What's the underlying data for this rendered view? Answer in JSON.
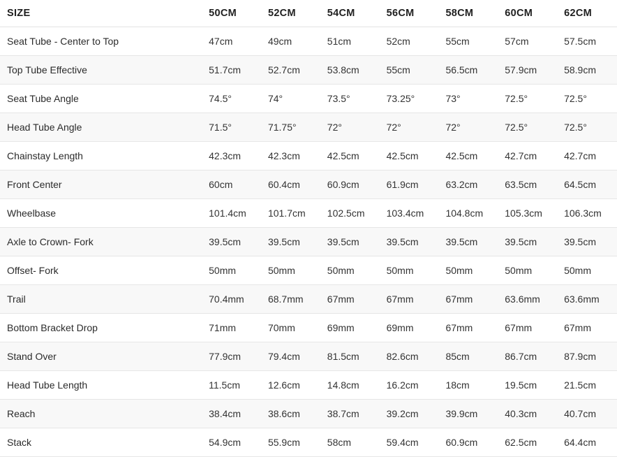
{
  "table": {
    "label_header": "SIZE",
    "size_headers": [
      "50CM",
      "52CM",
      "54CM",
      "56CM",
      "58CM",
      "60CM",
      "62CM"
    ],
    "rows": [
      {
        "label": "Seat Tube - Center to Top",
        "values": [
          "47cm",
          "49cm",
          "51cm",
          "52cm",
          "55cm",
          "57cm",
          "57.5cm"
        ]
      },
      {
        "label": "Top Tube Effective",
        "values": [
          "51.7cm",
          "52.7cm",
          "53.8cm",
          "55cm",
          "56.5cm",
          "57.9cm",
          "58.9cm"
        ]
      },
      {
        "label": "Seat Tube Angle",
        "values": [
          "74.5°",
          "74°",
          "73.5°",
          "73.25°",
          "73°",
          "72.5°",
          "72.5°"
        ]
      },
      {
        "label": "Head Tube Angle",
        "values": [
          "71.5°",
          "71.75°",
          "72°",
          "72°",
          "72°",
          "72.5°",
          "72.5°"
        ]
      },
      {
        "label": "Chainstay Length",
        "values": [
          "42.3cm",
          "42.3cm",
          "42.5cm",
          "42.5cm",
          "42.5cm",
          "42.7cm",
          "42.7cm"
        ]
      },
      {
        "label": "Front Center",
        "values": [
          "60cm",
          "60.4cm",
          "60.9cm",
          "61.9cm",
          "63.2cm",
          "63.5cm",
          "64.5cm"
        ]
      },
      {
        "label": "Wheelbase",
        "values": [
          "101.4cm",
          "101.7cm",
          "102.5cm",
          "103.4cm",
          "104.8cm",
          "105.3cm",
          "106.3cm"
        ]
      },
      {
        "label": "Axle to Crown- Fork",
        "values": [
          "39.5cm",
          "39.5cm",
          "39.5cm",
          "39.5cm",
          "39.5cm",
          "39.5cm",
          "39.5cm"
        ]
      },
      {
        "label": "Offset- Fork",
        "values": [
          "50mm",
          "50mm",
          "50mm",
          "50mm",
          "50mm",
          "50mm",
          "50mm"
        ]
      },
      {
        "label": "Trail",
        "values": [
          "70.4mm",
          "68.7mm",
          "67mm",
          "67mm",
          "67mm",
          "63.6mm",
          "63.6mm"
        ]
      },
      {
        "label": "Bottom Bracket Drop",
        "values": [
          "71mm",
          "70mm",
          "69mm",
          "69mm",
          "67mm",
          "67mm",
          "67mm"
        ]
      },
      {
        "label": "Stand Over",
        "values": [
          "77.9cm",
          "79.4cm",
          "81.5cm",
          "82.6cm",
          "85cm",
          "86.7cm",
          "87.9cm"
        ]
      },
      {
        "label": "Head Tube Length",
        "values": [
          "11.5cm",
          "12.6cm",
          "14.8cm",
          "16.2cm",
          "18cm",
          "19.5cm",
          "21.5cm"
        ]
      },
      {
        "label": "Reach",
        "values": [
          "38.4cm",
          "38.6cm",
          "38.7cm",
          "39.2cm",
          "39.9cm",
          "40.3cm",
          "40.7cm"
        ]
      },
      {
        "label": "Stack",
        "values": [
          "54.9cm",
          "55.9cm",
          "58cm",
          "59.4cm",
          "60.9cm",
          "62.5cm",
          "64.4cm"
        ]
      }
    ]
  },
  "colors": {
    "background": "#ffffff",
    "stripe": "#f8f8f8",
    "border": "#e6e6e6",
    "header_text": "#1f1f1f",
    "body_text": "#2f2f2f"
  }
}
